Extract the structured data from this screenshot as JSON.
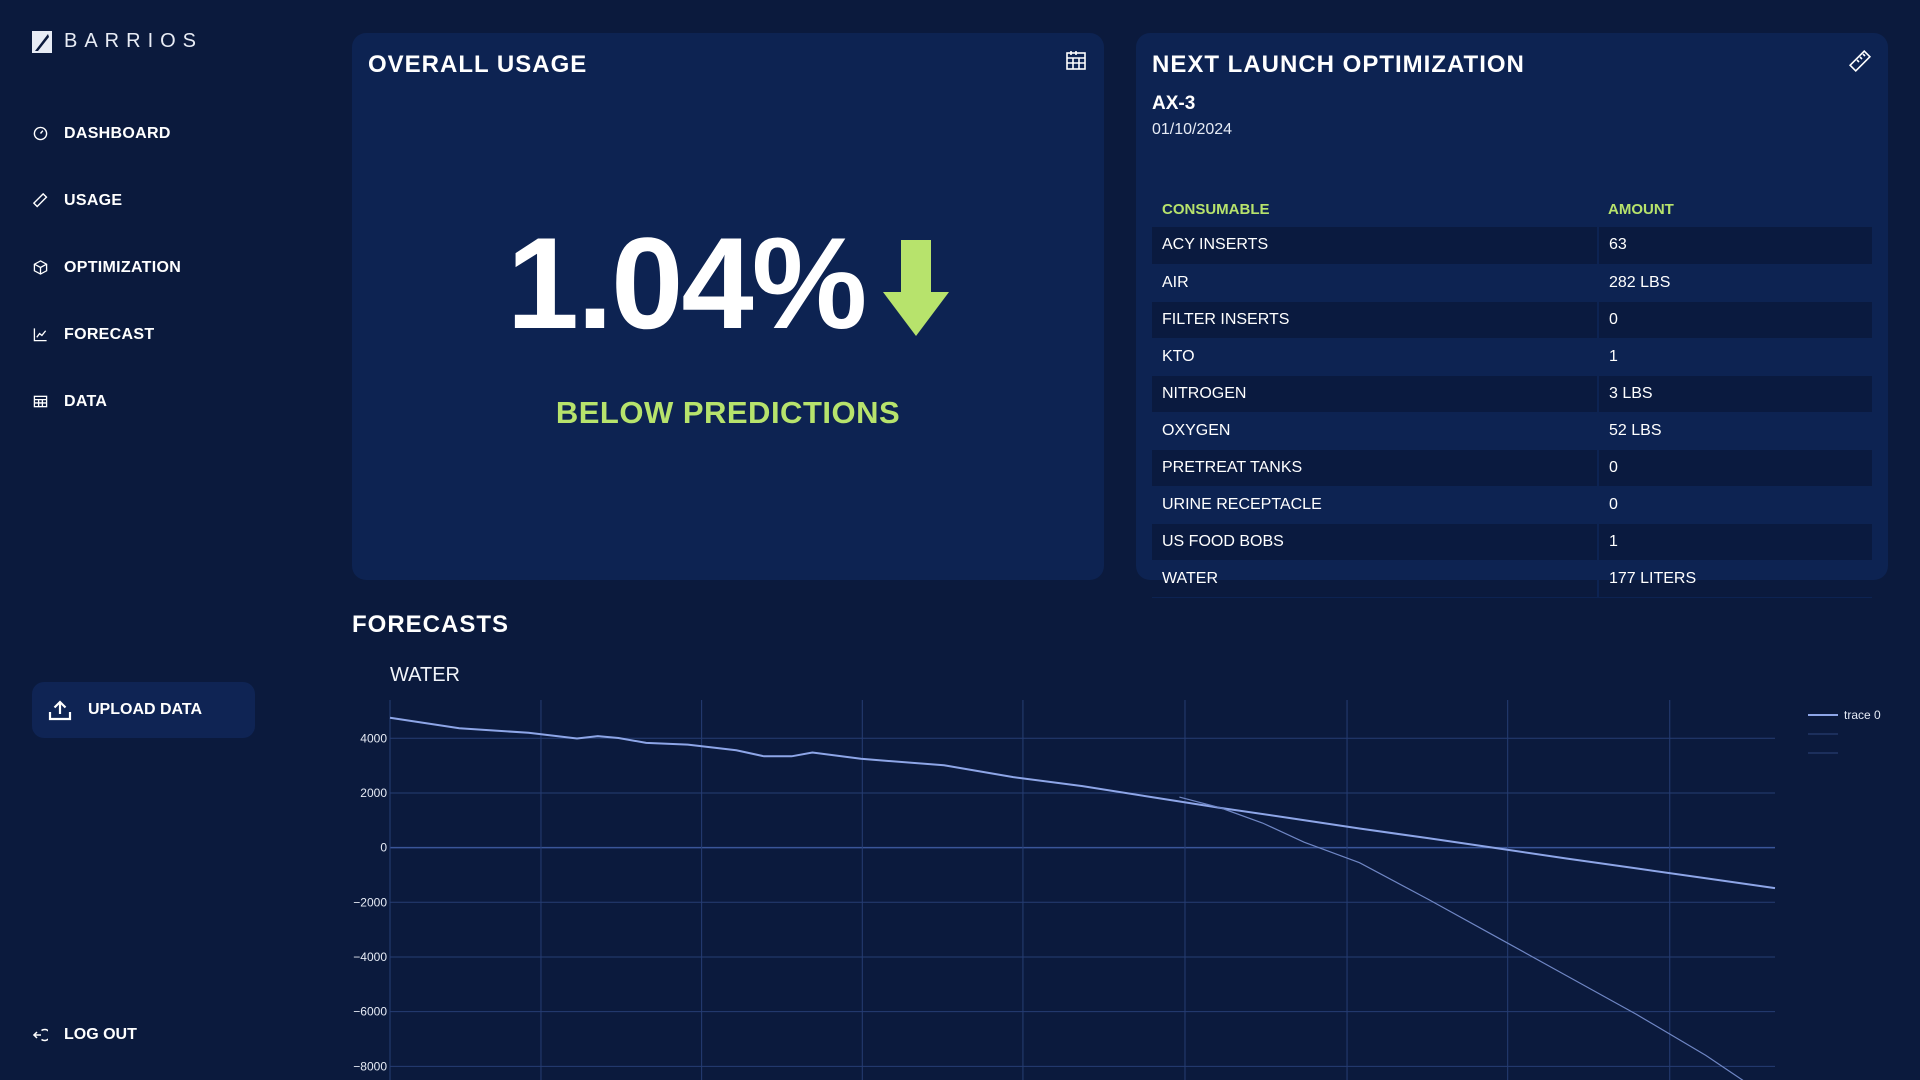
{
  "brand": {
    "name": "BARRIOS"
  },
  "sidebar": {
    "items": [
      {
        "label": "DASHBOARD",
        "icon": "gauge-icon"
      },
      {
        "label": "USAGE",
        "icon": "ruler-icon"
      },
      {
        "label": "OPTIMIZATION",
        "icon": "cube-icon"
      },
      {
        "label": "FORECAST",
        "icon": "line-chart-icon"
      },
      {
        "label": "DATA",
        "icon": "table-icon"
      }
    ],
    "upload_label": "UPLOAD DATA",
    "logout_label": "LOG OUT"
  },
  "usage_card": {
    "title": "OVERALL USAGE",
    "value": "1.04%",
    "status": "BELOW PREDICTIONS",
    "status_color": "#b7e36c"
  },
  "launch_card": {
    "title": "NEXT LAUNCH OPTIMIZATION",
    "mission": "AX-3",
    "date": "01/10/2024",
    "columns": [
      "CONSUMABLE",
      "AMOUNT"
    ],
    "rows": [
      [
        "ACY INSERTS",
        "63"
      ],
      [
        "AIR",
        "282 LBS"
      ],
      [
        "FILTER INSERTS",
        "0"
      ],
      [
        "KTO",
        "1"
      ],
      [
        "NITROGEN",
        "3 LBS"
      ],
      [
        "OXYGEN",
        "52 LBS"
      ],
      [
        "PRETREAT TANKS",
        "0"
      ],
      [
        "URINE RECEPTACLE",
        "0"
      ],
      [
        "US FOOD BOBS",
        "1"
      ],
      [
        "WATER",
        "177 LITERS"
      ]
    ]
  },
  "forecasts": {
    "section_title": "FORECASTS"
  },
  "chart_data": {
    "type": "line",
    "title": "WATER",
    "xlabel": "",
    "ylabel": "",
    "ylim": [
      -8500,
      5400
    ],
    "yticks": [
      4000,
      2000,
      0,
      -2000,
      -4000,
      -6000,
      -8000
    ],
    "ytick_labels": [
      "4000",
      "2000",
      "0",
      "−2000",
      "−4000",
      "−6000",
      "−8000"
    ],
    "xlim": [
      0,
      100
    ],
    "vertical_gridlines": [
      10.9,
      22.5,
      34.1,
      45.7,
      57.4,
      69.1,
      80.7,
      92.4
    ],
    "grid": true,
    "legend_position": "top-right",
    "series": [
      {
        "name": "trace 0",
        "color": "#8ea6e8",
        "x": [
          0,
          5,
          10,
          13.5,
          15,
          16.5,
          18.5,
          21.5,
          25,
          27,
          29,
          30.5,
          34,
          40,
          45,
          50,
          55,
          60,
          65,
          70,
          75,
          80,
          85,
          90,
          95,
          100
        ],
        "y": [
          4750,
          4370,
          4200,
          3990,
          4080,
          4010,
          3830,
          3770,
          3560,
          3340,
          3340,
          3480,
          3250,
          3010,
          2580,
          2250,
          1850,
          1450,
          1080,
          700,
          340,
          -30,
          -400,
          -760,
          -1120,
          -1480
        ]
      },
      {
        "name": "",
        "color": "#6f86c4",
        "x": [
          57,
          60,
          63,
          66,
          70,
          75,
          80,
          85,
          90,
          95,
          100
        ],
        "y": [
          1850,
          1450,
          900,
          200,
          -550,
          -1900,
          -3300,
          -4700,
          -6100,
          -7600,
          -9300
        ]
      }
    ]
  }
}
